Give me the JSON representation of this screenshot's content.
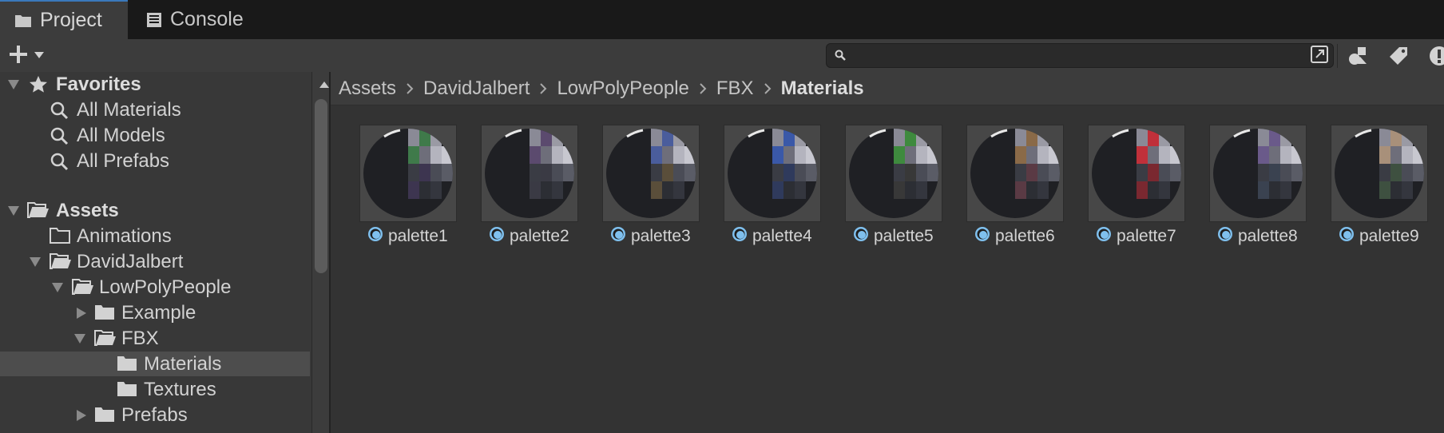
{
  "tabs": [
    {
      "label": "Project",
      "icon": "folder-icon",
      "active": true
    },
    {
      "label": "Console",
      "icon": "console-icon",
      "active": false
    }
  ],
  "toolbar": {
    "add_icon": "plus-icon",
    "search": {
      "value": "",
      "placeholder": ""
    }
  },
  "tree": {
    "favorites": {
      "label": "Favorites",
      "items": [
        "All Materials",
        "All Models",
        "All Prefabs"
      ]
    },
    "assets": {
      "label": "Assets",
      "animations": "Animations",
      "davidjalbert": "DavidJalbert",
      "lowpolypeople": "LowPolyPeople",
      "example": "Example",
      "fbx": "FBX",
      "materials": "Materials",
      "textures": "Textures",
      "prefabs": "Prefabs"
    }
  },
  "breadcrumb": [
    "Assets",
    "DavidJalbert",
    "LowPolyPeople",
    "FBX",
    "Materials"
  ],
  "materials": [
    {
      "name": "palette1",
      "accent": "#3f7a4a",
      "accent2": "#3d3550"
    },
    {
      "name": "palette2",
      "accent": "#5b4a6e",
      "accent2": "#3a3a44"
    },
    {
      "name": "palette3",
      "accent": "#4a5d9c",
      "accent2": "#5a4e3a"
    },
    {
      "name": "palette4",
      "accent": "#3a58a8",
      "accent2": "#2f3a5c"
    },
    {
      "name": "palette5",
      "accent": "#3e8a3e",
      "accent2": "#383838"
    },
    {
      "name": "palette6",
      "accent": "#8a6a48",
      "accent2": "#5a3a44"
    },
    {
      "name": "palette7",
      "accent": "#c0303a",
      "accent2": "#7a2830"
    },
    {
      "name": "palette8",
      "accent": "#6a5a8a",
      "accent2": "#3a4250"
    },
    {
      "name": "palette9",
      "accent": "#a8907a",
      "accent2": "#3e5040"
    }
  ],
  "colors": {
    "active_tab_accent": "#3a79bb",
    "selection": "#4d4d4d",
    "material_icon": "#7fc0ee"
  }
}
